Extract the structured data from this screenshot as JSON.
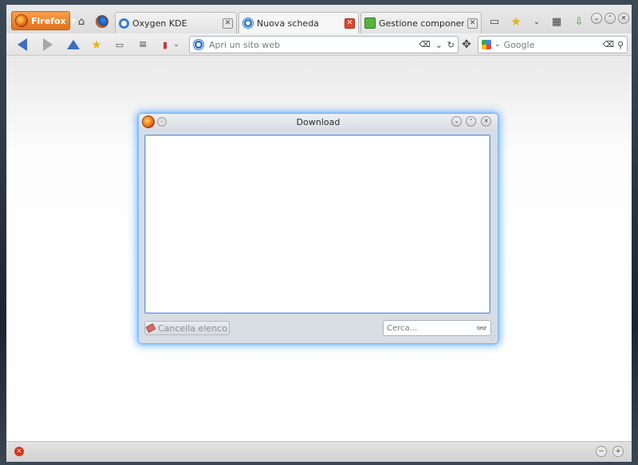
{
  "browser": {
    "menu_button_label": "Firefox",
    "tabs": [
      {
        "label": "Oxygen KDE",
        "favicon": "oxygen-icon"
      },
      {
        "label": "Nuova scheda",
        "favicon": "ie-icon"
      },
      {
        "label": "Gestione componenti a...",
        "favicon": "puzzle-icon"
      }
    ],
    "url_placeholder": "Apri un sito web",
    "search_placeholder": "Google"
  },
  "dialog": {
    "title": "Download",
    "clear_button_label": "Cancella elenco",
    "search_placeholder": "Cerca..."
  },
  "colors": {
    "firefox_button": "#e4711b",
    "dialog_glow": "#6fb7ff",
    "accent_blue": "#3c6ec2"
  }
}
